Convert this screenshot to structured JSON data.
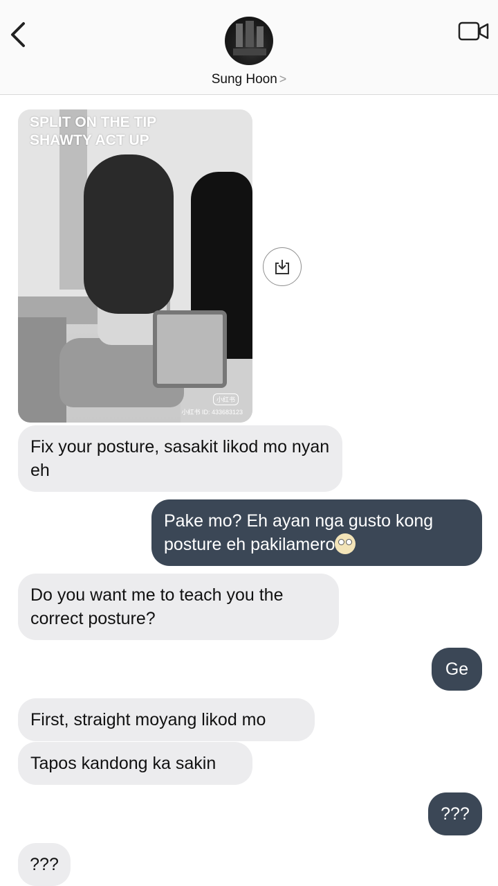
{
  "header": {
    "contact_name": "Sung Hoon",
    "chevron": ">"
  },
  "shared_image": {
    "caption_line1": "SPLIT ON THE TIP",
    "caption_line2": "SHAWTY ACT UP",
    "watermark": "小红书",
    "id_text": "小红书 ID: 433683123"
  },
  "messages": [
    {
      "side": "in",
      "text": "Fix your posture, sasakit likod mo nyan eh"
    },
    {
      "side": "out",
      "text": "Pake mo? Eh ayan nga gusto kong posture eh pakilamero"
    },
    {
      "side": "in",
      "text": "Do you want me to teach you the correct posture?"
    },
    {
      "side": "out",
      "text": "Ge"
    },
    {
      "side": "in",
      "text": "First, straight moyang likod mo"
    },
    {
      "side": "in",
      "text": "Tapos kandong ka sakin"
    },
    {
      "side": "out",
      "text": "???"
    },
    {
      "side": "in",
      "text": "???"
    }
  ],
  "icons": {
    "back": "chevron-left-icon",
    "video": "video-call-icon",
    "download": "download-icon",
    "emoji": "eye-roll-emoji"
  },
  "colors": {
    "incoming_bubble": "#ececee",
    "outgoing_bubble": "#3b4756"
  }
}
